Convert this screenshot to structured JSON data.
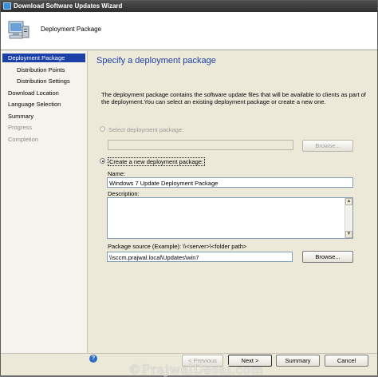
{
  "window": {
    "title": "Download Software Updates Wizard"
  },
  "header": {
    "title": "Deployment Package"
  },
  "nav": {
    "items": [
      {
        "label": "Deployment Package"
      },
      {
        "label": "Distribution Points"
      },
      {
        "label": "Distribution Settings"
      },
      {
        "label": "Download Location"
      },
      {
        "label": "Language Selection"
      },
      {
        "label": "Summary"
      },
      {
        "label": "Progress"
      },
      {
        "label": "Completion"
      }
    ]
  },
  "main": {
    "title": "Specify a deployment package",
    "description": "The deployment package contains the software update files that will be available to clients as part of the deployment.You can select an existing deployment package or create a new one.",
    "select_existing": {
      "label": "Select deployment package:",
      "value": "",
      "browse_label": "Browse..."
    },
    "create_new": {
      "label": "Create a new deployment package:"
    },
    "name": {
      "label": "Name:",
      "value": "Windows 7 Update Deployment Package"
    },
    "description_field": {
      "label": "Description:",
      "value": ""
    },
    "package_source": {
      "label": "Package source (Example): \\\\<server>\\<folder path>",
      "value": "\\\\sccm.prajwal.local\\Updates\\win7",
      "browse_label": "Browse..."
    }
  },
  "footer": {
    "previous_label": "< Previous",
    "next_label": "Next >",
    "summary_label": "Summary",
    "cancel_label": "Cancel"
  },
  "watermark": {
    "text": "©PrajwalDesai.com"
  },
  "colors": {
    "accent": "#1c3fa8",
    "background": "#ece9d8"
  }
}
